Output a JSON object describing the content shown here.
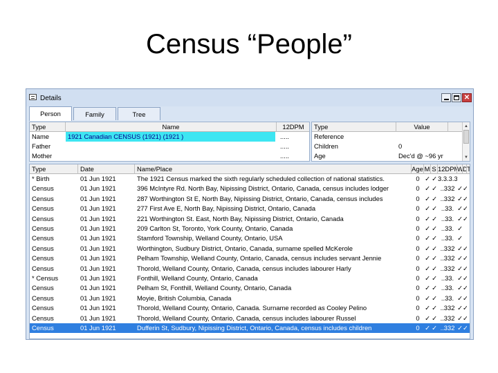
{
  "slide": {
    "title": "Census “People”"
  },
  "window": {
    "title": "Details",
    "icon": "details-icon",
    "controls": {
      "minimize": "minimize-icon",
      "maximize": "maximize-icon",
      "close": "✕"
    }
  },
  "tabs": [
    {
      "label": "Person",
      "active": true
    },
    {
      "label": "Family",
      "active": false
    },
    {
      "label": "Tree",
      "active": false
    }
  ],
  "names_grid": {
    "headers": {
      "type": "Type",
      "name": "Name",
      "dpm": "12DPM"
    },
    "rows": [
      {
        "type": "Name",
        "name": "1921 Canadian CENSUS (1921) (1921 )",
        "dpm": "....."
      },
      {
        "type": "Father",
        "name": "",
        "dpm": "....."
      },
      {
        "type": "Mother",
        "name": "",
        "dpm": "....."
      }
    ]
  },
  "facts_grid": {
    "headers": {
      "type": "Type",
      "value": "Value"
    },
    "rows": [
      {
        "type": "Reference",
        "value": ""
      },
      {
        "type": "Children",
        "value": "0"
      },
      {
        "type": "Age",
        "value": "Dec'd @ ~96 yr"
      }
    ]
  },
  "events_grid": {
    "headers": {
      "type": "Type",
      "date": "Date",
      "place": "Name/Place",
      "age": "Age",
      "m": "M",
      "s": "S",
      "dpm": "12DPM",
      "w": "W",
      "d": "D",
      "t": "T"
    },
    "rows": [
      {
        "type": "* Birth",
        "date": "01 Jun 1921",
        "place": "The 1921 Census marked the sixth regularly scheduled collection of national statistics.",
        "age": "0",
        "m": "✓",
        "s": "✓",
        "dpm": "3.3.3.3",
        "w": "",
        "d": "",
        "t": ""
      },
      {
        "type": "Census",
        "date": "01 Jun 1921",
        "place": "396 McIntyre Rd. North Bay, Nipissing District, Ontario, Canada, census includes lodger",
        "age": "0",
        "m": "✓",
        "s": "✓",
        "dpm": "..332",
        "w": "✓",
        "d": "✓",
        "t": ""
      },
      {
        "type": "Census",
        "date": "01 Jun 1921",
        "place": "287 Worthington St E, North Bay, Nipissing District, Ontario, Canada, census includes",
        "age": "0",
        "m": "✓",
        "s": "✓",
        "dpm": "..332",
        "w": "✓",
        "d": "✓",
        "t": ""
      },
      {
        "type": "Census",
        "date": "01 Jun 1921",
        "place": "277 First Ave E, North Bay, Nipissing District, Ontario, Canada",
        "age": "0",
        "m": "✓",
        "s": "✓",
        "dpm": "..33.",
        "w": "✓",
        "d": "✓",
        "t": ""
      },
      {
        "type": "Census",
        "date": "01 Jun 1921",
        "place": "221 Worthington St. East, North Bay, Nipissing District, Ontario, Canada",
        "age": "0",
        "m": "✓",
        "s": "✓",
        "dpm": "..33.",
        "w": "✓",
        "d": "✓",
        "t": ""
      },
      {
        "type": "Census",
        "date": "01 Jun 1921",
        "place": "209 Carlton St, Toronto, York County, Ontario, Canada",
        "age": "0",
        "m": "✓",
        "s": "✓",
        "dpm": "..33.",
        "w": "✓",
        "d": "",
        "t": ""
      },
      {
        "type": "Census",
        "date": "01 Jun 1921",
        "place": "Stamford Township, Welland County, Ontario, USA",
        "age": "0",
        "m": "✓",
        "s": "✓",
        "dpm": "..33.",
        "w": "✓",
        "d": "",
        "t": ""
      },
      {
        "type": "Census",
        "date": "01 Jun 1921",
        "place": "Worthington, Sudbury District, Ontario, Canada, surname spelled McKerole",
        "age": "0",
        "m": "✓",
        "s": "✓",
        "dpm": "..332",
        "w": "✓",
        "d": "✓",
        "t": ""
      },
      {
        "type": "Census",
        "date": "01 Jun 1921",
        "place": "Pelham Township, Welland County, Ontario, Canada, census includes servant Jennie",
        "age": "0",
        "m": "✓",
        "s": "✓",
        "dpm": "..332",
        "w": "✓",
        "d": "✓",
        "t": ""
      },
      {
        "type": "Census",
        "date": "01 Jun 1921",
        "place": "Thorold, Welland County, Ontario, Canada, census includes labourer Harly",
        "age": "0",
        "m": "✓",
        "s": "✓",
        "dpm": "..332",
        "w": "✓",
        "d": "✓",
        "t": ""
      },
      {
        "type": "* Census",
        "date": "01 Jun 1921",
        "place": "Fonthill, Welland County, Ontario, Canada",
        "age": "0",
        "m": "✓",
        "s": "✓",
        "dpm": "..33.",
        "w": "✓",
        "d": "✓",
        "t": ""
      },
      {
        "type": "Census",
        "date": "01 Jun 1921",
        "place": "Pelham St, Fonthill, Welland County, Ontario, Canada",
        "age": "0",
        "m": "✓",
        "s": "✓",
        "dpm": "..33.",
        "w": "✓",
        "d": "✓",
        "t": ""
      },
      {
        "type": "Census",
        "date": "01 Jun 1921",
        "place": "Moyie, British Columbia, Canada",
        "age": "0",
        "m": "✓",
        "s": "✓",
        "dpm": "..33.",
        "w": "✓",
        "d": "✓",
        "t": ""
      },
      {
        "type": "Census",
        "date": "01 Jun 1921",
        "place": "Thorold, Welland County, Ontario, Canada. Surname recorded as Cooley Pelino",
        "age": "0",
        "m": "✓",
        "s": "✓",
        "dpm": "..332",
        "w": "✓",
        "d": "✓",
        "t": ""
      },
      {
        "type": "Census",
        "date": "01 Jun 1921",
        "place": "Thorold, Welland County, Ontario, Canada, census includes labourer Russel",
        "age": "0",
        "m": "✓",
        "s": "✓",
        "dpm": "..332",
        "w": "✓",
        "d": "✓",
        "t": ""
      },
      {
        "type": "Census",
        "date": "01 Jun 1921",
        "place": "Dufferin St, Sudbury, Nipissing District, Ontario, Canada, census includes children",
        "age": "0",
        "m": "✓",
        "s": "✓",
        "dpm": "..332",
        "w": "✓",
        "d": "✓",
        "t": "",
        "selected": true
      }
    ]
  },
  "colors": {
    "name_highlight": "#3ee6f2",
    "selection": "#2f7fe0",
    "window_frame": "#d8e4f3"
  }
}
